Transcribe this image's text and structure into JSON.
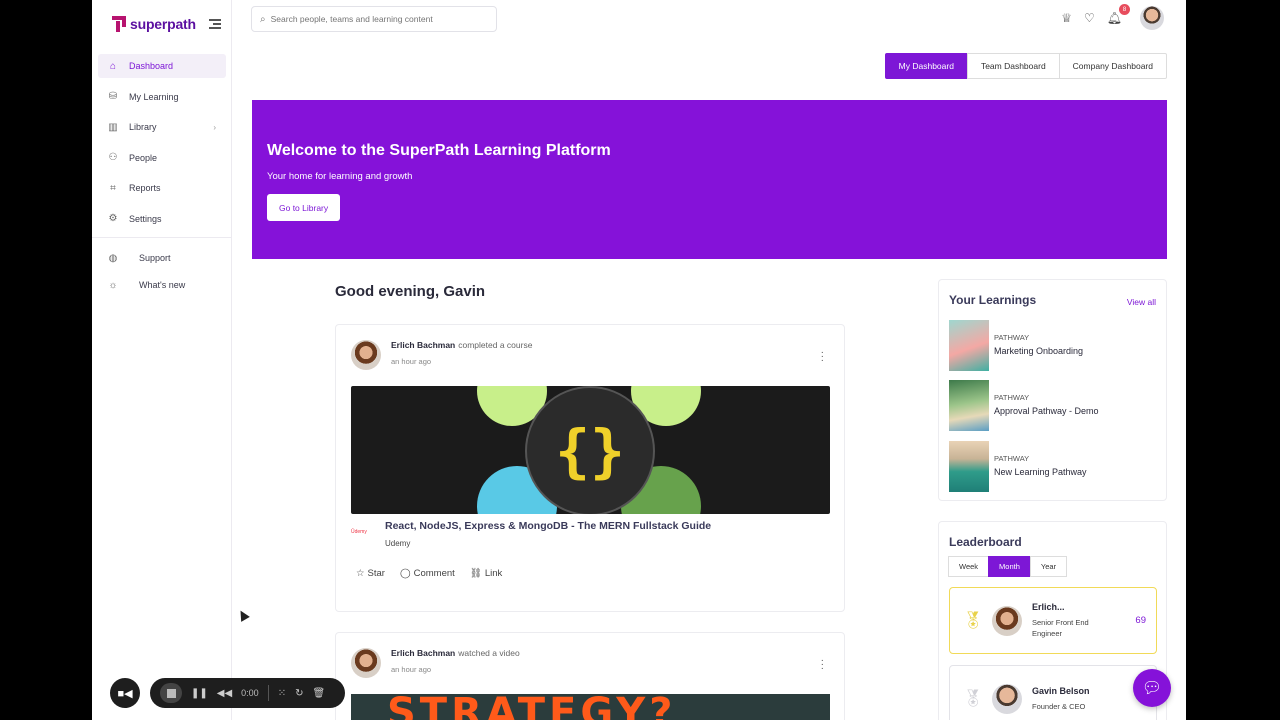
{
  "brand": {
    "name": "superpath",
    "accent": "#7d17d6",
    "logo_color": "#b7136f"
  },
  "sidebar": {
    "items": [
      {
        "label": "Dashboard",
        "icon": "home-icon",
        "active": true
      },
      {
        "label": "My Learning",
        "icon": "graduation-icon"
      },
      {
        "label": "Library",
        "icon": "library-icon",
        "chevron": true
      },
      {
        "label": "People",
        "icon": "people-icon"
      },
      {
        "label": "Reports",
        "icon": "chart-icon"
      },
      {
        "label": "Settings",
        "icon": "gear-icon"
      }
    ],
    "secondary": [
      {
        "label": "Support",
        "icon": "globe-icon"
      },
      {
        "label": "What's new",
        "icon": "bulb-icon"
      }
    ]
  },
  "topbar": {
    "search_placeholder": "Search people, teams and learning content",
    "notifications_count": "8"
  },
  "dashboard_tabs": [
    "My Dashboard",
    "Team Dashboard",
    "Company Dashboard"
  ],
  "hero": {
    "title": "Welcome to the SuperPath Learning Platform",
    "subtitle": "Your home for learning and growth",
    "button": "Go to Library",
    "color": "#8512d9"
  },
  "greeting": "Good evening, Gavin",
  "feed": [
    {
      "author": "Erlich Bachman",
      "action": "completed a course",
      "time": "an hour ago",
      "course_title": "React, NodeJS, Express & MongoDB - The MERN Fullstack Guide",
      "provider": "Udemy",
      "actions": [
        "Star",
        "Comment",
        "Link"
      ]
    },
    {
      "author": "Erlich Bachman",
      "action": "watched a video",
      "time": "an hour ago",
      "thumb_text": "STRATEGY?"
    }
  ],
  "your_learnings": {
    "title": "Your Learnings",
    "view_all": "View all",
    "items": [
      {
        "type": "PATHWAY",
        "name": "Marketing Onboarding"
      },
      {
        "type": "PATHWAY",
        "name": "Approval Pathway - Demo"
      },
      {
        "type": "PATHWAY",
        "name": "New Learning Pathway"
      }
    ]
  },
  "leaderboard": {
    "title": "Leaderboard",
    "tabs": [
      "Week",
      "Month",
      "Year"
    ],
    "active_tab": "Month",
    "rows": [
      {
        "name": "Erlich...",
        "role": "Senior Front End Engineer",
        "score": "69",
        "medal": "gold"
      },
      {
        "name": "Gavin Belson",
        "role": "Founder & CEO",
        "score": "",
        "medal": "silver"
      }
    ]
  },
  "recorder": {
    "time": "0:00"
  }
}
